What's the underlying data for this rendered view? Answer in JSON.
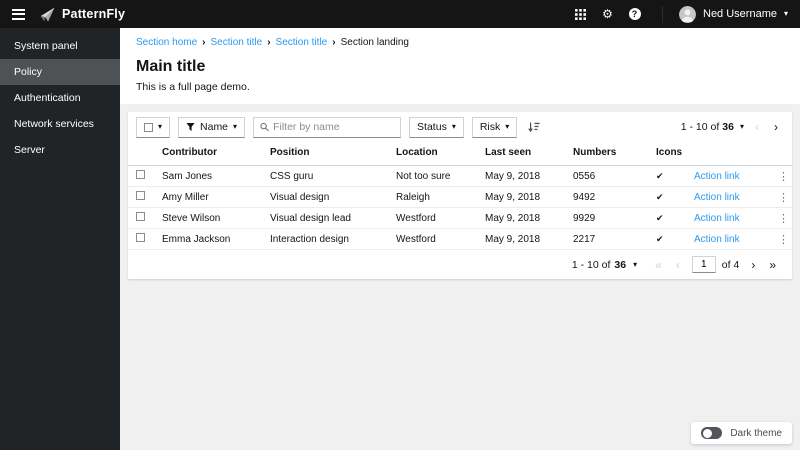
{
  "masthead": {
    "brand": "PatternFly",
    "user_name": "Ned Username"
  },
  "sidebar": {
    "items": [
      {
        "label": "System panel",
        "selected": false
      },
      {
        "label": "Policy",
        "selected": true
      },
      {
        "label": "Authentication",
        "selected": false
      },
      {
        "label": "Network services",
        "selected": false
      },
      {
        "label": "Server",
        "selected": false
      }
    ]
  },
  "breadcrumb": {
    "separator": "›",
    "items": [
      {
        "label": "Section home"
      },
      {
        "label": "Section title"
      },
      {
        "label": "Section title"
      },
      {
        "label": "Section landing"
      }
    ]
  },
  "page": {
    "title": "Main title",
    "subtitle": "This is a full page demo."
  },
  "toolbar": {
    "name_filter_label": "Name",
    "search_placeholder": "Filter by name",
    "status_label": "Status",
    "risk_label": "Risk"
  },
  "pagination_top": {
    "range_text": "1 - 10 of",
    "total": "36"
  },
  "pagination_bottom": {
    "range_text": "1 - 10 of",
    "total": "36",
    "current_page": "1",
    "pages_label": "of 4"
  },
  "table": {
    "columns": [
      "Contributor",
      "Position",
      "Location",
      "Last seen",
      "Numbers",
      "Icons"
    ],
    "action_label": "Action link",
    "rows": [
      {
        "contributor": "Sam Jones",
        "position": "CSS guru",
        "location": "Not too sure",
        "last_seen": "May 9, 2018",
        "numbers": "0556"
      },
      {
        "contributor": "Amy Miller",
        "position": "Visual design",
        "location": "Raleigh",
        "last_seen": "May 9, 2018",
        "numbers": "9492"
      },
      {
        "contributor": "Steve Wilson",
        "position": "Visual design lead",
        "location": "Westford",
        "last_seen": "May 9, 2018",
        "numbers": "9929"
      },
      {
        "contributor": "Emma Jackson",
        "position": "Interaction design",
        "location": "Westford",
        "last_seen": "May 9, 2018",
        "numbers": "2217"
      }
    ]
  },
  "dark_theme_label": "Dark theme",
  "icons": {
    "check": "✔",
    "kebab": "⋮",
    "caret_down": "▾",
    "angle_left": "‹",
    "angle_right": "›",
    "angle_double_left": "«",
    "angle_double_right": "»",
    "gear": "⚙",
    "help": "?"
  },
  "colors": {
    "link": "#2b9af3",
    "masthead_bg": "#151515",
    "sidebar_bg": "#212427",
    "sidebar_selected_bg": "#4f5255",
    "page_bg": "#f0f0f0",
    "card_bg": "#ffffff"
  }
}
